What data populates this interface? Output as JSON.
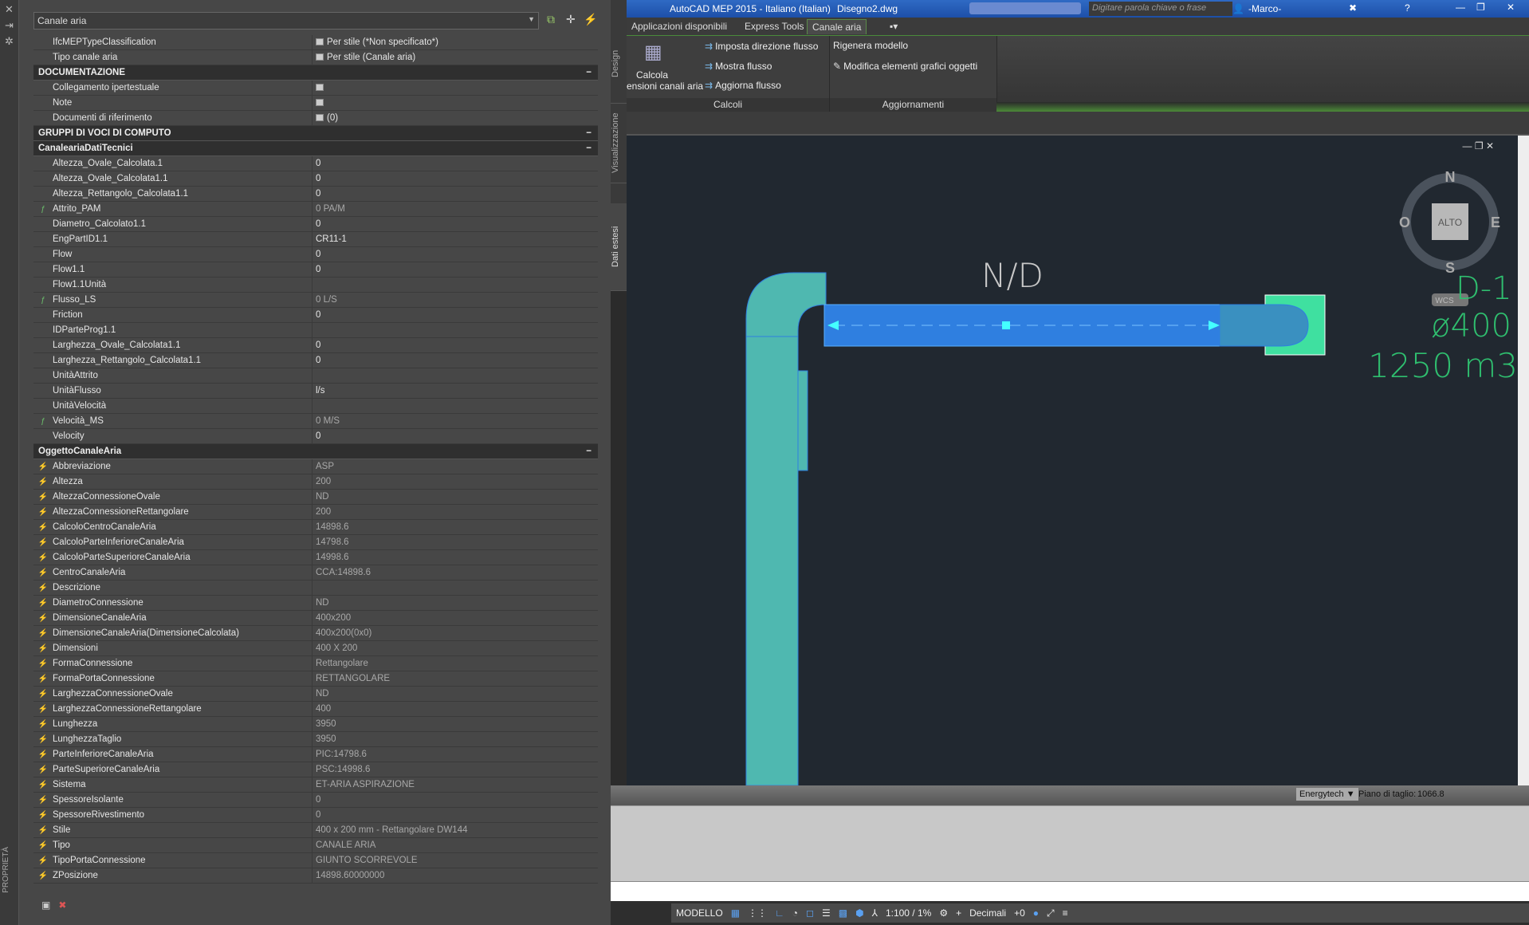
{
  "window": {
    "title": "AutoCAD MEP 2015 - Italiano (Italian)",
    "file": "Disegno2.dwg",
    "search_placeholder": "Digitare parola chiave o frase",
    "user": "-Marco-"
  },
  "ribbon": {
    "tabs": [
      "Applicazioni disponibili",
      "Express Tools",
      "Canale aria"
    ],
    "active_tab": "Canale aria",
    "calcoli": {
      "label": "Calcoli",
      "big_l1": "Calcola",
      "big_l2": "ensioni canali aria",
      "buttons": [
        "Imposta direzione flusso",
        "Mostra flusso",
        "Aggiorna flusso"
      ]
    },
    "aggiornamenti": {
      "label": "Aggiornamenti",
      "buttons": [
        "Rigenera modello",
        "Modifica elementi grafici oggetti"
      ]
    }
  },
  "properties": {
    "title": "PROPRIETÀ",
    "selector": "Canale aria",
    "side_tabs": [
      "Design",
      "Visualizzazione",
      "Dati estesi"
    ],
    "top_rows": [
      {
        "k": "IfcMEPTypeClassification",
        "v": "Per stile (*Non specificato*)"
      },
      {
        "k": "Tipo canale aria",
        "v": "Per stile (Canale aria)"
      }
    ],
    "sections": [
      {
        "title": "DOCUMENTAZIONE",
        "rows": [
          {
            "k": "Collegamento ipertestuale",
            "v": "",
            "doc": true
          },
          {
            "k": "Note",
            "v": "",
            "doc": true
          },
          {
            "k": "Documenti di riferimento",
            "v": "(0)",
            "doc": true
          }
        ]
      },
      {
        "title": "GRUPPI DI VOCI DI COMPUTO",
        "rows": []
      },
      {
        "title": "CanaleariaDatiTecnici",
        "rows": [
          {
            "k": "Altezza_Ovale_Calcolata.1",
            "v": "0"
          },
          {
            "k": "Altezza_Ovale_Calcolata1.1",
            "v": "0"
          },
          {
            "k": "Altezza_Rettangolo_Calcolata1.1",
            "v": "0"
          },
          {
            "k": "Attrito_PAM",
            "v": "0 PA/M",
            "f": true
          },
          {
            "k": "Diametro_Calcolato1.1",
            "v": "0"
          },
          {
            "k": "EngPartID1.1",
            "v": "CR11-1"
          },
          {
            "k": "Flow",
            "v": "0"
          },
          {
            "k": "Flow1.1",
            "v": "0"
          },
          {
            "k": "Flow1.1Unità",
            "v": ""
          },
          {
            "k": "Flusso_LS",
            "v": "0 L/S",
            "f": true
          },
          {
            "k": "Friction",
            "v": "0"
          },
          {
            "k": "IDParteProg1.1",
            "v": ""
          },
          {
            "k": "Larghezza_Ovale_Calcolata1.1",
            "v": "0"
          },
          {
            "k": "Larghezza_Rettangolo_Calcolata1.1",
            "v": "0"
          },
          {
            "k": "UnitàAttrito",
            "v": ""
          },
          {
            "k": "UnitàFlusso",
            "v": "l/s"
          },
          {
            "k": "UnitàVelocità",
            "v": ""
          },
          {
            "k": "Velocità_MS",
            "v": "0 M/S",
            "f": true
          },
          {
            "k": "Velocity",
            "v": "0"
          }
        ]
      },
      {
        "title": "OggettoCanaleAria",
        "ro": true,
        "rows": [
          {
            "k": "Abbreviazione",
            "v": "ASP"
          },
          {
            "k": "Altezza",
            "v": "200"
          },
          {
            "k": "AltezzaConnessioneOvale",
            "v": "ND"
          },
          {
            "k": "AltezzaConnessioneRettangolare",
            "v": "200"
          },
          {
            "k": "CalcoloCentroCanaleAria",
            "v": "14898.6"
          },
          {
            "k": "CalcoloParteInferioreCanaleAria",
            "v": "14798.6"
          },
          {
            "k": "CalcoloParteSuperioreCanaleAria",
            "v": "14998.6"
          },
          {
            "k": "CentroCanaleAria",
            "v": "CCA:14898.6"
          },
          {
            "k": "Descrizione",
            "v": ""
          },
          {
            "k": "DiametroConnessione",
            "v": "ND"
          },
          {
            "k": "DimensioneCanaleAria",
            "v": "400x200"
          },
          {
            "k": "DimensioneCanaleAria(DimensioneCalcolata)",
            "v": "400x200(0x0)"
          },
          {
            "k": "Dimensioni",
            "v": "400 X 200"
          },
          {
            "k": "FormaConnessione",
            "v": "Rettangolare"
          },
          {
            "k": "FormaPortaConnessione",
            "v": "RETTANGOLARE"
          },
          {
            "k": "LarghezzaConnessioneOvale",
            "v": "ND"
          },
          {
            "k": "LarghezzaConnessioneRettangolare",
            "v": "400"
          },
          {
            "k": "Lunghezza",
            "v": "3950"
          },
          {
            "k": "LunghezzaTaglio",
            "v": "3950"
          },
          {
            "k": "ParteInferioreCanaleAria",
            "v": "PIC:14798.6"
          },
          {
            "k": "ParteSuperioreCanaleAria",
            "v": "PSC:14998.6"
          },
          {
            "k": "Sistema",
            "v": "ET-ARIA ASPIRAZIONE"
          },
          {
            "k": "SpessoreIsolante",
            "v": "0"
          },
          {
            "k": "SpessoreRivestimento",
            "v": "0"
          },
          {
            "k": "Stile",
            "v": "400 x 200 mm - Rettangolare DW144"
          },
          {
            "k": "Tipo",
            "v": "CANALE ARIA"
          },
          {
            "k": "TipoPortaConnessione",
            "v": "GIUNTO SCORREVOLE"
          },
          {
            "k": "ZPosizione",
            "v": "14898.60000000"
          }
        ]
      }
    ]
  },
  "drawing": {
    "label_nd": "N/D",
    "tag": "D-1",
    "diameter": "ø400",
    "flow": "1250 m3",
    "compass": {
      "n": "N",
      "s": "S",
      "e": "E",
      "o": "O",
      "center": "ALTO",
      "ucs": "WCS"
    },
    "duct_color": "#2f7fe0",
    "fitting_color": "#4fb8b0",
    "text_color": "#2fbf6f"
  },
  "status": {
    "style": "Energytech",
    "cut_plane_label": "Piano di taglio:",
    "cut_plane": "1066.8",
    "model": "MODELLO",
    "scale": "1:100 / 1%",
    "units": "Decimali",
    "offset": "+0"
  }
}
